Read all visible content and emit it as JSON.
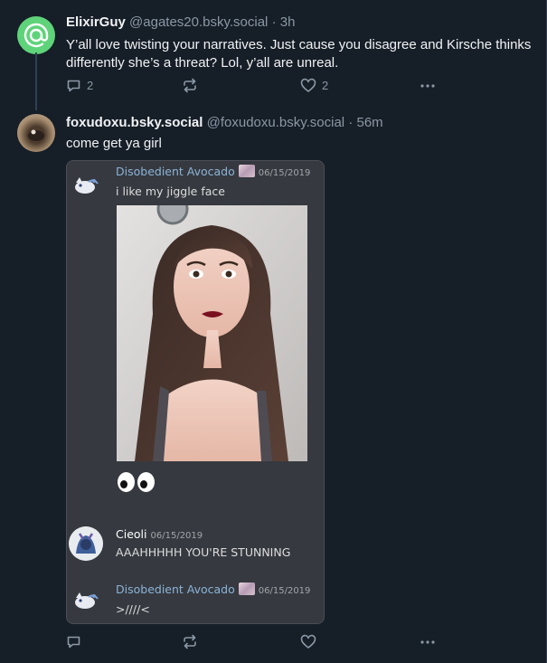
{
  "posts": [
    {
      "display_name": "ElixirGuy",
      "handle": "@agates20.bsky.social",
      "time": "· 3h",
      "text": "Y’all love twisting your narratives. Just cause you disagree and Kirsche thinks differently she’s a threat? Lol, y’all are unreal.",
      "reply_count": "2",
      "repost_count": "",
      "like_count": "2",
      "avatar_color": "#5fd37a",
      "avatar_icon": "at-sign-icon"
    },
    {
      "display_name": "foxudoxu.bsky.social",
      "handle": "@foxudoxu.bsky.social",
      "time": "· 56m",
      "text": "come get ya girl",
      "reply_count": "",
      "repost_count": "",
      "like_count": ""
    }
  ],
  "embed": {
    "messages": [
      {
        "author": "Disobedient Avocado",
        "date": "06/15/2019",
        "text": "i like my jiggle face",
        "name_color": "#8ab4d8"
      },
      {
        "author": "Cieoli",
        "date": "06/15/2019",
        "text": "AAAHHHHH YOU'RE STUNNING",
        "name_color": "#ffffff"
      },
      {
        "author": "Disobedient Avocado",
        "date": "06/15/2019",
        "text": ">////<",
        "name_color": "#8ab4d8"
      }
    ],
    "emoji": "eyes-emoji"
  },
  "colors": {
    "background": "#161e27",
    "muted": "#8b98a5",
    "embed_bg": "#36393f"
  }
}
